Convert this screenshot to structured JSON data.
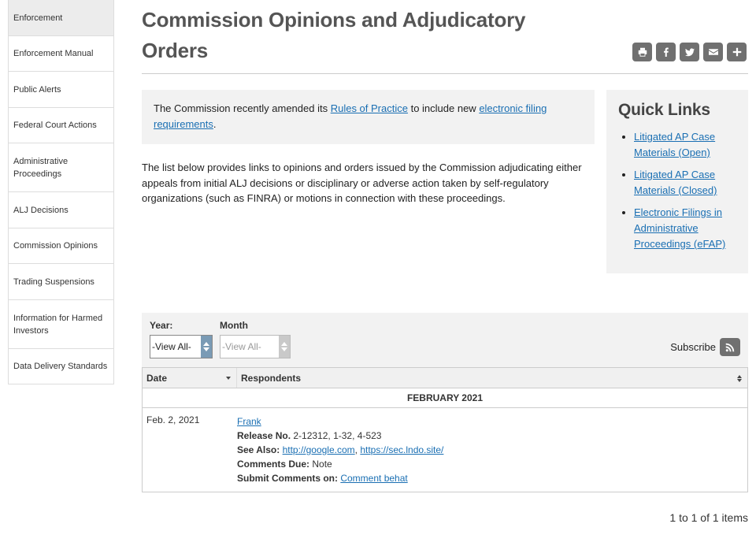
{
  "sidebar": {
    "items": [
      {
        "label": "Enforcement",
        "active": true
      },
      {
        "label": "Enforcement Manual"
      },
      {
        "label": "Public Alerts"
      },
      {
        "label": "Federal Court Actions"
      },
      {
        "label": "Administrative Proceedings"
      },
      {
        "label": "ALJ Decisions"
      },
      {
        "label": "Commission Opinions"
      },
      {
        "label": "Trading Suspensions"
      },
      {
        "label": "Information for Harmed Investors"
      },
      {
        "label": "Data Delivery Standards"
      }
    ]
  },
  "page": {
    "title": "Commission Opinions and Adjudicatory Orders"
  },
  "share": {
    "icons": [
      "print-icon",
      "facebook-icon",
      "twitter-icon",
      "email-icon",
      "plus-icon"
    ]
  },
  "notice": {
    "text_before": "The Commission recently amended its ",
    "link1": "Rules of Practice",
    "text_middle": " to include new ",
    "link2": "electronic filing requirements",
    "text_after": "."
  },
  "intro": {
    "text": "The list below provides links to opinions and orders issued by the Commission adjudicating either appeals from initial ALJ decisions or disciplinary or adverse action taken by self-regulatory organizations (such as FINRA) or motions in connection with these proceedings."
  },
  "quick_links": {
    "title": "Quick Links",
    "items": [
      "Litigated AP Case Materials (Open)",
      "Litigated AP Case Materials (Closed)",
      "Electronic Filings in Administrative Proceedings (eFAP)"
    ]
  },
  "filters": {
    "year_label": "Year:",
    "year_value": "-View All-",
    "month_label": "Month",
    "month_value": "-View All-",
    "subscribe_label": "Subscribe"
  },
  "table": {
    "headers": {
      "date": "Date",
      "respondents": "Respondents"
    },
    "group": "FEBRUARY 2021",
    "rows": [
      {
        "date": "Feb. 2, 2021",
        "respondent": "Frank",
        "release_label": "Release No.",
        "release_value": " 2-12312, 1-32, 4-523",
        "see_also_label": "See Also:",
        "see_also_link1": "http://google.com",
        "see_also_sep": ", ",
        "see_also_link2": "https://sec.lndo.site/",
        "comments_due_label": "Comments Due:",
        "comments_due_value": " Note",
        "submit_label": "Submit Comments on:",
        "submit_link": "Comment behat"
      }
    ]
  },
  "pager": {
    "text": "1 to 1 of 1 items"
  }
}
